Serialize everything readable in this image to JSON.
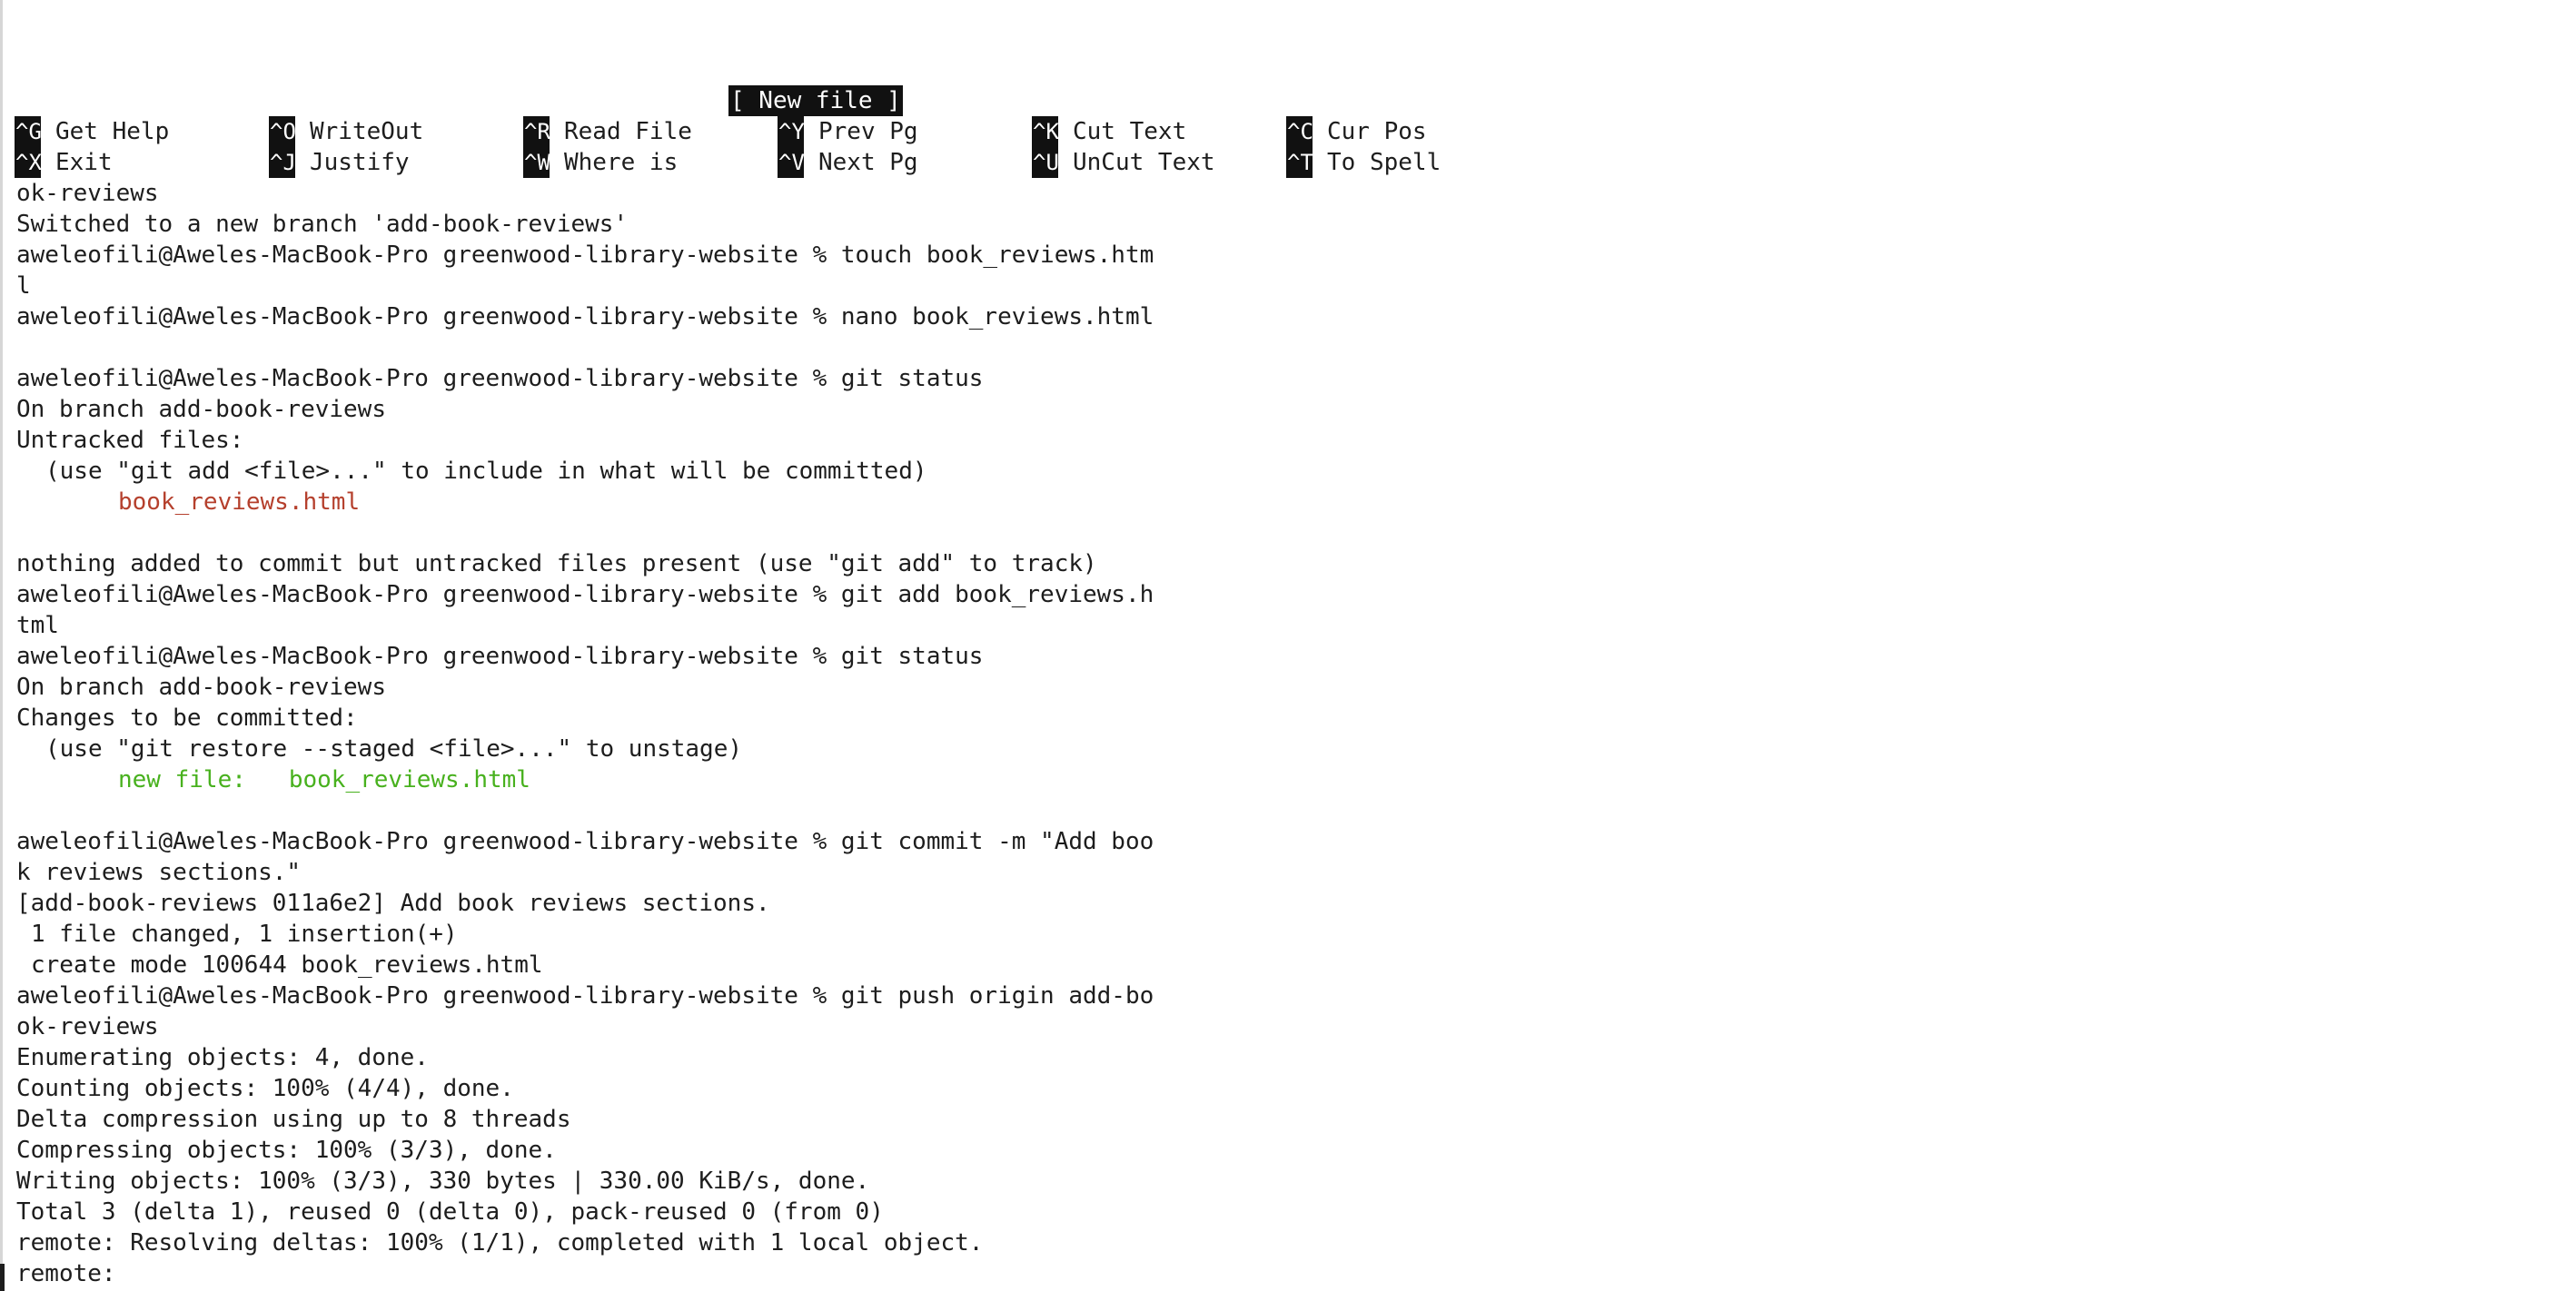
{
  "nano": {
    "status_message": "[ New file ]",
    "shortcuts_row1": [
      {
        "key": "^G",
        "label": "Get Help"
      },
      {
        "key": "^O",
        "label": "WriteOut"
      },
      {
        "key": "^R",
        "label": "Read File"
      },
      {
        "key": "^Y",
        "label": "Prev Pg"
      },
      {
        "key": "^K",
        "label": "Cut Text"
      },
      {
        "key": "^C",
        "label": "Cur Pos"
      }
    ],
    "shortcuts_row2": [
      {
        "key": "^X",
        "label": "Exit"
      },
      {
        "key": "^J",
        "label": "Justify"
      },
      {
        "key": "^W",
        "label": "Where is"
      },
      {
        "key": "^V",
        "label": "Next Pg"
      },
      {
        "key": "^U",
        "label": "UnCut Text"
      },
      {
        "key": "^T",
        "label": "To Spell"
      }
    ]
  },
  "terminal": {
    "lines": [
      "ok-reviews",
      "Switched to a new branch 'add-book-reviews'",
      "aweleofili@Aweles-MacBook-Pro greenwood-library-website % touch book_reviews.htm",
      "l",
      "aweleofili@Aweles-MacBook-Pro greenwood-library-website % nano book_reviews.html",
      "",
      "aweleofili@Aweles-MacBook-Pro greenwood-library-website % git status",
      "On branch add-book-reviews",
      "Untracked files:",
      "(use \"git add <file>...\" to include in what will be committed)",
      "book_reviews.html",
      "",
      "nothing added to commit but untracked files present (use \"git add\" to track)",
      "aweleofili@Aweles-MacBook-Pro greenwood-library-website % git add book_reviews.h",
      "tml",
      "aweleofili@Aweles-MacBook-Pro greenwood-library-website % git status",
      "On branch add-book-reviews",
      "Changes to be committed:",
      "(use \"git restore --staged <file>...\" to unstage)",
      "new file:   book_reviews.html",
      "",
      "aweleofili@Aweles-MacBook-Pro greenwood-library-website % git commit -m \"Add boo",
      "k reviews sections.\"",
      "[add-book-reviews 011a6e2] Add book reviews sections.",
      "1 file changed, 1 insertion(+)",
      "create mode 100644 book_reviews.html",
      "aweleofili@Aweles-MacBook-Pro greenwood-library-website % git push origin add-bo",
      "ok-reviews",
      "Enumerating objects: 4, done.",
      "Counting objects: 100% (4/4), done.",
      "Delta compression using up to 8 threads",
      "Compressing objects: 100% (3/3), done.",
      "Writing objects: 100% (3/3), 330 bytes | 330.00 KiB/s, done.",
      "Total 3 (delta 1), reused 0 (delta 0), pack-reused 0 (from 0)",
      "remote: Resolving deltas: 100% (1/1), completed with 1 local object.",
      "remote:"
    ]
  },
  "colors": {
    "untracked_file": "#b5402d",
    "staged_file": "#48b11e",
    "highlight_bg": "#111111"
  }
}
